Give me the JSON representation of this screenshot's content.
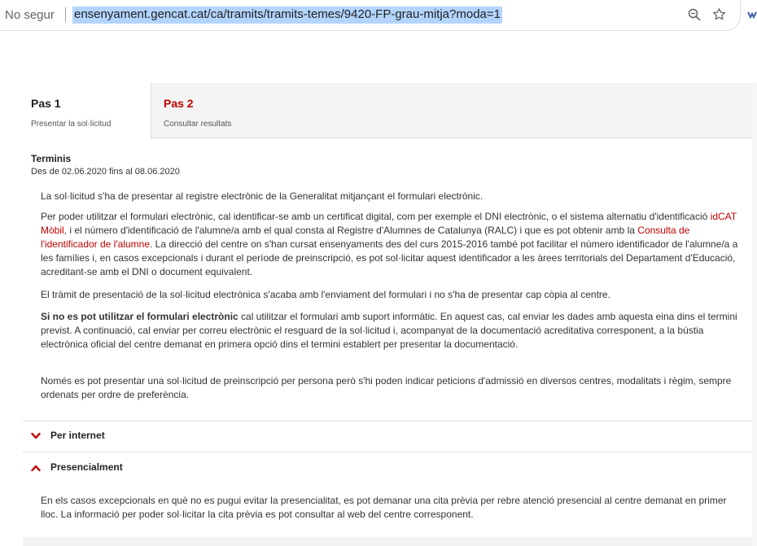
{
  "browser": {
    "security_label": "No segur",
    "url": "ensenyament.gencat.cat/ca/tramits/tramits-temes/9420-FP-grau-mitja?moda=1",
    "icons": [
      "zoom-icon",
      "star-icon",
      "extension-icon"
    ]
  },
  "steps": [
    {
      "title": "Pas 1",
      "subtitle": "Presentar la sol·licitud",
      "active": true
    },
    {
      "title": "Pas 2",
      "subtitle": "Consultar resultats",
      "active": false
    }
  ],
  "terminis": {
    "title": "Terminis",
    "dates": "Des de 02.06.2020 fins al  08.06.2020"
  },
  "paragraphs": {
    "p1": "La sol·licitud s'ha de presentar al registre electrònic de la Generalitat mitjançant el formulari electrònic.",
    "p2_a": "Per poder utilitzar el formulari electrònic, cal identificar-se amb un certificat digital, com per exemple el DNI electrònic, o el sistema alternatiu d'identificació ",
    "p2_link1": "idCAT Mòbil",
    "p2_b": ", i el número d'identificació de l'alumne/a amb el qual consta al Registre d'Alumnes de Catalunya (RALC) i que es pot obtenir amb la ",
    "p2_link2": "Consulta de l'identificador de l'alumne",
    "p2_c": ". La direcció del centre on s'han cursat ensenyaments des del curs 2015-2016 també pot facilitar el número identificador de l'alumne/a a les famílies i, en casos excepcionals i durant el període de preinscripció, es pot sol·licitar aquest identificador a les àrees territorials del Departament d'Educació, acreditant-se amb el DNI o document equivalent.",
    "p3": "El tràmit de presentació de la sol·licitud electrònica s'acaba amb l'enviament del formulari i no s'ha de presentar cap còpia al centre.",
    "p4_bold": "Si no es pot utilitzar el formulari electrònic",
    "p4_rest": " cal utilitzar el formulari amb suport informàtic. En aquest cas, cal enviar les dades amb aquesta eina dins el termini previst. A continuació, cal enviar per correu electrònic el resguard de la sol·licitud i, acompanyat de la documentació acreditativa corresponent, a la bústia electrònica oficial del centre demanat en primera opció dins el termini establert per presentar la documentació.",
    "p5": "Només es pot presentar una sol·licitud de preinscripció per persona però s'hi poden indicar peticions d'admissió en diversos centres, modalitats i règim, sempre ordenats per ordre de preferència."
  },
  "accordion": [
    {
      "label": "Per internet",
      "expanded": false,
      "icon": "chevron-down-icon"
    },
    {
      "label": "Presencialment",
      "expanded": true,
      "icon": "chevron-up-icon"
    }
  ],
  "presencial_text": "En els casos excepcionals en què no es pugui evitar la presencialitat, es pot demanar una cita prèvia per rebre atenció presencial al centre demanat en primer lloc. La informació per poder sol·licitar la cita prèvia es pot consultar al web del centre corresponent.",
  "colors": {
    "accent": "#c00000",
    "url_highlight": "#b3d5fd"
  }
}
